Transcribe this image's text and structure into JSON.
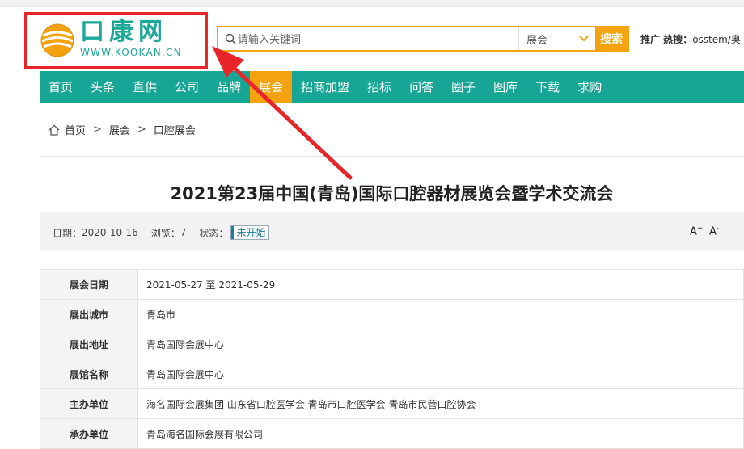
{
  "header": {
    "logo_cn": "口康网",
    "logo_en": "WWW.KOOKAN.CN",
    "search_placeholder": "请输入关键词",
    "search_category": "展会",
    "search_button": "搜索",
    "hot_search_label": "推广 热搜：",
    "hot_search_term": "osstem/奥"
  },
  "nav": {
    "items": [
      "首页",
      "头条",
      "直供",
      "公司",
      "品牌",
      "展会",
      "招商加盟",
      "招标",
      "问答",
      "圈子",
      "图库",
      "下载",
      "求购"
    ],
    "active_index": 5
  },
  "breadcrumb": {
    "items": [
      "首页",
      "展会",
      "口腔展会"
    ]
  },
  "article": {
    "title": "2021第23届中国(青岛)国际口腔器材展览会暨学术交流会",
    "date_label": "日期：",
    "date": "2020-10-16",
    "views_label": "浏览：",
    "views": "7",
    "status_label": "状态：",
    "status": "未开始",
    "font_increase": "A",
    "font_decrease": "A"
  },
  "details": [
    {
      "label": "展会日期",
      "value": "2021-05-27 至 2021-05-29"
    },
    {
      "label": "展出城市",
      "value": "青岛市"
    },
    {
      "label": "展出地址",
      "value": "青岛国际会展中心"
    },
    {
      "label": "展馆名称",
      "value": "青岛国际会展中心"
    },
    {
      "label": "主办单位",
      "value": "海名国际会展集团 山东省口腔医学会 青岛市口腔医学会 青岛市民营口腔协会"
    },
    {
      "label": "承办单位",
      "value": "青岛海名国际会展有限公司"
    }
  ],
  "colors": {
    "brand_teal": "#17a596",
    "accent_orange": "#f5a20f",
    "annotation_red": "#e8262a"
  }
}
